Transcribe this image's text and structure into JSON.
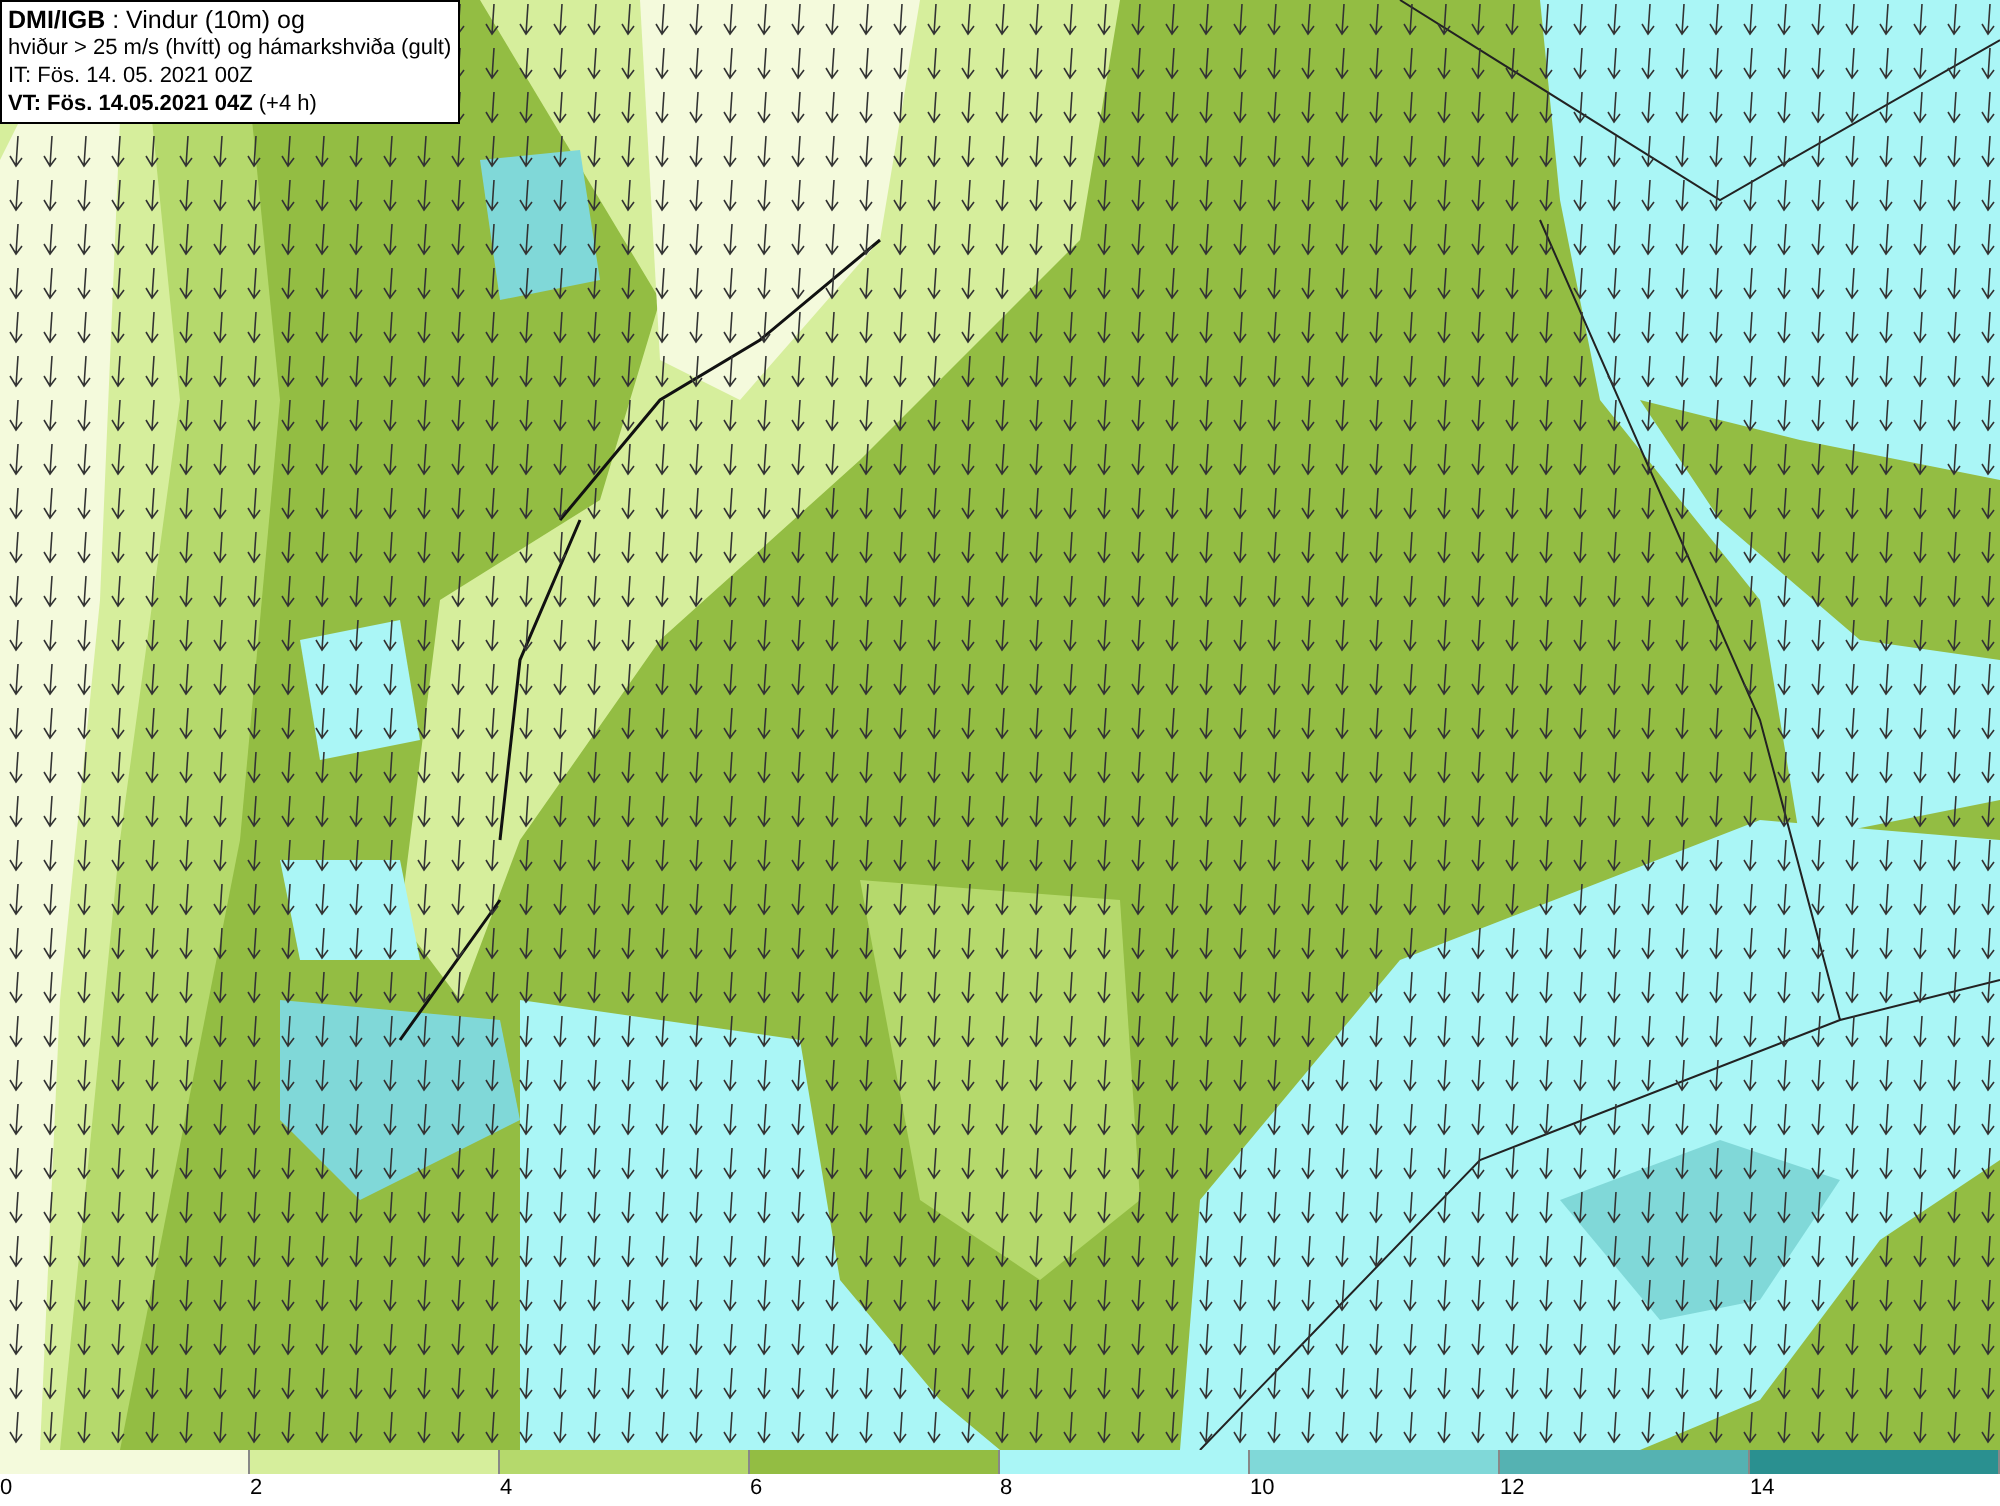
{
  "title_box": {
    "lines": [
      "**DMI/IGB** : Vindur (10m) og",
      "hviður > 25 m/s (hvítt) og hámarkshviða (gult)",
      "IT: Fös. 14. 05. 2021 00Z",
      "**VT: Fös. 14.05.2021 04Z** (+4 h)"
    ]
  },
  "legend": [
    {
      "label": "0",
      "color": "#f4fadc"
    },
    {
      "label": "2",
      "color": "#d6ee9c"
    },
    {
      "label": "4",
      "color": "#b5d96c"
    },
    {
      "label": "6",
      "color": "#93bd43"
    },
    {
      "label": "8",
      "color": "#aaf6f6"
    },
    {
      "label": "10",
      "color": "#80d8d8"
    },
    {
      "label": "12",
      "color": "#55b2b2"
    },
    {
      "label": "14",
      "color": "#2a9090"
    }
  ]
}
